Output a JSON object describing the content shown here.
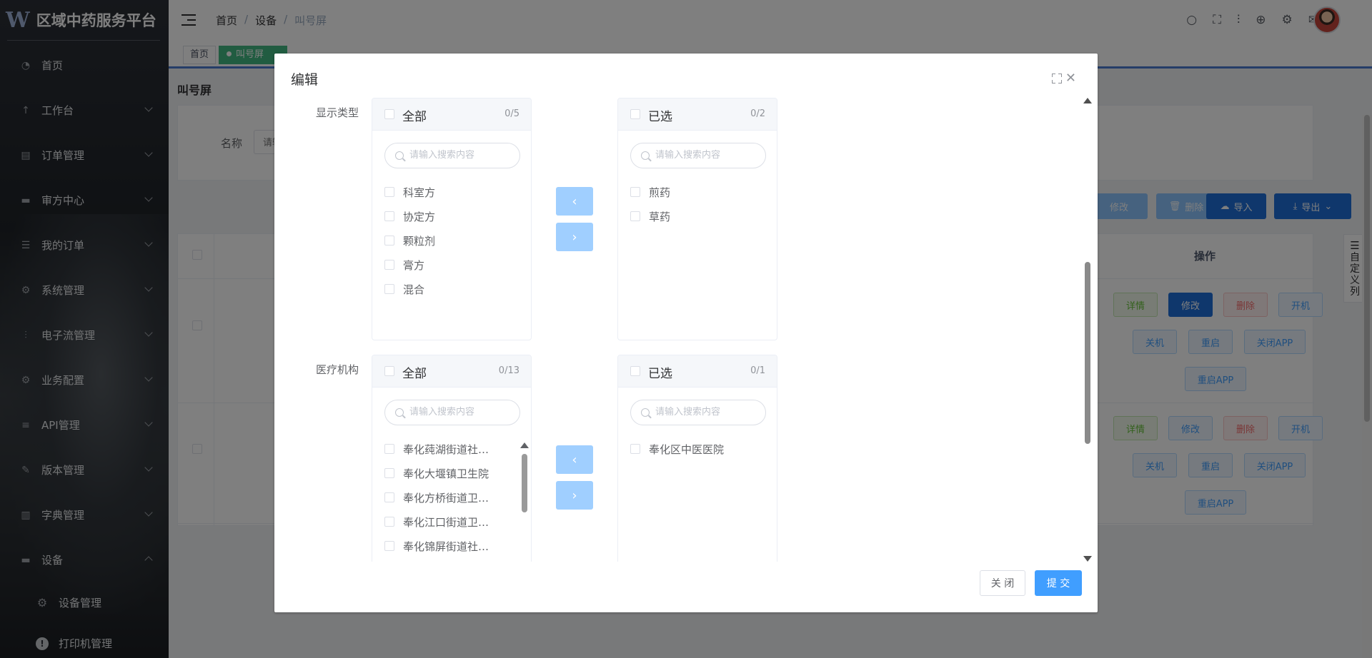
{
  "app": {
    "logo_mark": "W",
    "title": "区域中药服务平台"
  },
  "sidebar": {
    "items": [
      {
        "label": "首页",
        "icon": "dashboard-icon",
        "chevron": false
      },
      {
        "label": "工作台",
        "icon": "arrow-up-icon",
        "chevron": true
      },
      {
        "label": "订单管理",
        "icon": "order-icon",
        "chevron": true
      },
      {
        "label": "审方中心",
        "icon": "monitor-icon",
        "chevron": true
      },
      {
        "label": "我的订单",
        "icon": "list-icon",
        "chevron": true
      },
      {
        "label": "系统管理",
        "icon": "gear-icon",
        "chevron": true
      },
      {
        "label": "电子流管理",
        "icon": "flow-icon",
        "chevron": true
      },
      {
        "label": "业务配置",
        "icon": "gear-icon",
        "chevron": true
      },
      {
        "label": "API管理",
        "icon": "sliders-icon",
        "chevron": true
      },
      {
        "label": "版本管理",
        "icon": "edit-icon",
        "chevron": true
      },
      {
        "label": "字典管理",
        "icon": "document-icon",
        "chevron": true
      },
      {
        "label": "设备",
        "icon": "monitor-icon",
        "chevron": true,
        "expanded": true
      }
    ],
    "sub_items": [
      {
        "label": "设备管理",
        "icon": "gear-icon"
      },
      {
        "label": "打印机管理",
        "icon": "alert-icon"
      }
    ]
  },
  "header": {
    "breadcrumb": [
      "首页",
      "设备",
      "叫号屏"
    ],
    "breadcrumb_sep": "/"
  },
  "tags": [
    "首页",
    "叫号屏"
  ],
  "page": {
    "title": "叫号屏",
    "search_label": "名称",
    "search_placeholder": "请输入名称",
    "toolbar": {
      "modify": "修改",
      "delete": "删除",
      "import": "导入",
      "export": "导出"
    },
    "table": {
      "op_header": "操作",
      "row_buttons": {
        "detail": "详情",
        "modify": "修改",
        "delete": "删除",
        "power_on": "开机",
        "power_off": "关机",
        "restart": "重启",
        "close_app": "关闭APP",
        "restart_app": "重启APP"
      }
    },
    "custom_columns": "自定义列"
  },
  "dialog": {
    "title": "编辑",
    "display_type": {
      "label": "显示类型",
      "left": {
        "title": "全部",
        "count": "0/5",
        "search_placeholder": "请输入搜索内容",
        "items": [
          "科室方",
          "协定方",
          "颗粒剂",
          "膏方",
          "混合"
        ]
      },
      "right": {
        "title": "已选",
        "count": "0/2",
        "search_placeholder": "请输入搜索内容",
        "items": [
          "煎药",
          "草药"
        ]
      }
    },
    "institution": {
      "label": "医疗机构",
      "left": {
        "title": "全部",
        "count": "0/13",
        "search_placeholder": "请输入搜索内容",
        "items": [
          "奉化莼湖街道社…",
          "奉化大堰镇卫生院",
          "奉化方桥街道卫…",
          "奉化江口街道卫…",
          "奉化锦屏街道社…"
        ]
      },
      "right": {
        "title": "已选",
        "count": "0/1",
        "search_placeholder": "请输入搜索内容",
        "items": [
          "奉化区中医医院"
        ]
      }
    },
    "arrows": {
      "left": "‹",
      "right": "›"
    },
    "footer": {
      "close": "关 闭",
      "submit": "提 交"
    }
  },
  "colors": {
    "primary": "#409eff",
    "active_tag": "#42b983",
    "sidebar_bg": "#2b2f36"
  }
}
